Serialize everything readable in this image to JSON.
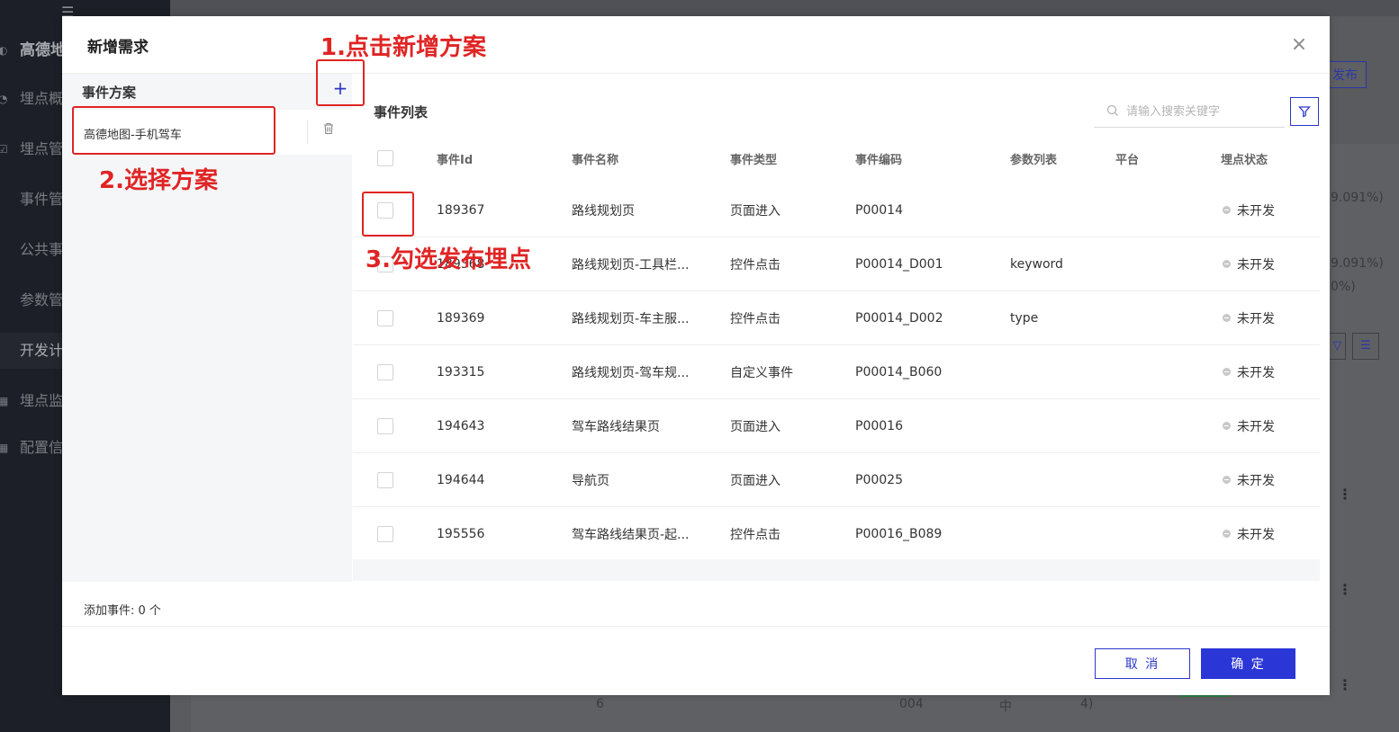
{
  "background": {
    "sidebar_items": [
      {
        "label": "高德地",
        "icon": "brand-logo-icon"
      },
      {
        "label": "埋点概",
        "icon": "pie-chart-icon"
      },
      {
        "label": "埋点管",
        "icon": "list-icon"
      },
      {
        "label": "事件管",
        "icon": ""
      },
      {
        "label": "公共事",
        "icon": ""
      },
      {
        "label": "参数管",
        "icon": ""
      },
      {
        "label": "开发计",
        "icon": ""
      },
      {
        "label": "埋点监",
        "icon": "grid-icon"
      },
      {
        "label": "配置信",
        "icon": "grid-icon"
      }
    ],
    "publish_label": "发布",
    "pct_values": [
      "9.091%)",
      "9.091%)",
      "0%)"
    ],
    "bottom_values": [
      "6",
      "004",
      "中",
      "4)"
    ]
  },
  "modal": {
    "title": "新增需求",
    "close_symbol": "×",
    "left_panel": {
      "title": "事件方案",
      "add_symbol": "+",
      "plan_label": "高德地图-手机驾车"
    },
    "right_panel": {
      "title": "事件列表",
      "search_placeholder": "请输入搜索关键字"
    },
    "table": {
      "columns": [
        "事件Id",
        "事件名称",
        "事件类型",
        "事件编码",
        "参数列表",
        "平台",
        "埋点状态"
      ],
      "rows": [
        {
          "id": "189367",
          "name": "路线规划页",
          "type": "页面进入",
          "code": "P00014",
          "params": "",
          "platform": "",
          "status": "未开发"
        },
        {
          "id": "189368",
          "name": "路线规划页-工具栏...",
          "type": "控件点击",
          "code": "P00014_D001",
          "params": "keyword",
          "platform": "",
          "status": "未开发"
        },
        {
          "id": "189369",
          "name": "路线规划页-车主服...",
          "type": "控件点击",
          "code": "P00014_D002",
          "params": "type",
          "platform": "",
          "status": "未开发"
        },
        {
          "id": "193315",
          "name": "路线规划页-驾车规...",
          "type": "自定义事件",
          "code": "P00014_B060",
          "params": "",
          "platform": "",
          "status": "未开发"
        },
        {
          "id": "194643",
          "name": "驾车路线结果页",
          "type": "页面进入",
          "code": "P00016",
          "params": "",
          "platform": "",
          "status": "未开发"
        },
        {
          "id": "194644",
          "name": "导航页",
          "type": "页面进入",
          "code": "P00025",
          "params": "",
          "platform": "",
          "status": "未开发"
        },
        {
          "id": "195556",
          "name": "驾车路线结果页-起...",
          "type": "控件点击",
          "code": "P00016_B089",
          "params": "",
          "platform": "",
          "status": "未开发"
        }
      ]
    },
    "footer": {
      "count_text": "添加事件: 0 个",
      "cancel_label": "取 消",
      "ok_label": "确 定"
    }
  },
  "annotations": {
    "step1": "1.点击新增方案",
    "step2": "2.选择方案",
    "step3": "3.勾选发布埋点"
  },
  "colors": {
    "accent": "#2b36d6",
    "annotation_red": "#e02424",
    "sidebar_bg": "#1c1f27"
  }
}
